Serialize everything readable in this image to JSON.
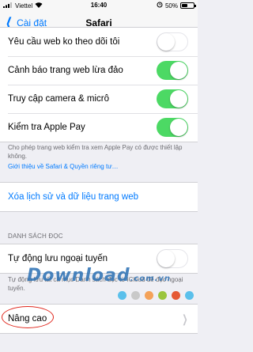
{
  "status_bar": {
    "carrier": "Viettel",
    "time": "16:40",
    "battery": "50%",
    "battery_level": 0.5
  },
  "nav": {
    "back_label": "Cài đặt",
    "title": "Safari"
  },
  "privacy_rows": [
    {
      "label": "Yêu cầu web ko theo dõi tôi",
      "on": false
    },
    {
      "label": "Cảnh báo trang web lừa đảo",
      "on": true
    },
    {
      "label": "Truy cập camera & micrô",
      "on": true
    },
    {
      "label": "Kiểm tra Apple Pay",
      "on": true
    }
  ],
  "apple_pay_footer": "Cho phép trang web kiểm tra xem Apple Pay có được thiết lập không.",
  "privacy_link": "Giới thiệu về Safari & Quyền riêng tư…",
  "clear_history": "Xóa lịch sử và dữ liệu trang web",
  "reading_list": {
    "header": "DANH SÁCH ĐỌC",
    "auto_save_label": "Tự động lưu ngoại tuyến",
    "auto_save_on": false,
    "footer": "Tự động lưu tất cả mục Danh sách đọc từ iCloud để đọc ngoại tuyến."
  },
  "advanced": {
    "label": "Nâng cao"
  },
  "watermark": {
    "text": "Download",
    "suffix": ".com.vn"
  },
  "colors": {
    "accent": "#007aff",
    "toggle_on": "#4cd964",
    "annotation": "#e0261c"
  },
  "watermark_dots": [
    "#5bc0eb",
    "#c9c9c9",
    "#f4a259",
    "#9bc53d",
    "#e55934",
    "#5bc0eb"
  ]
}
